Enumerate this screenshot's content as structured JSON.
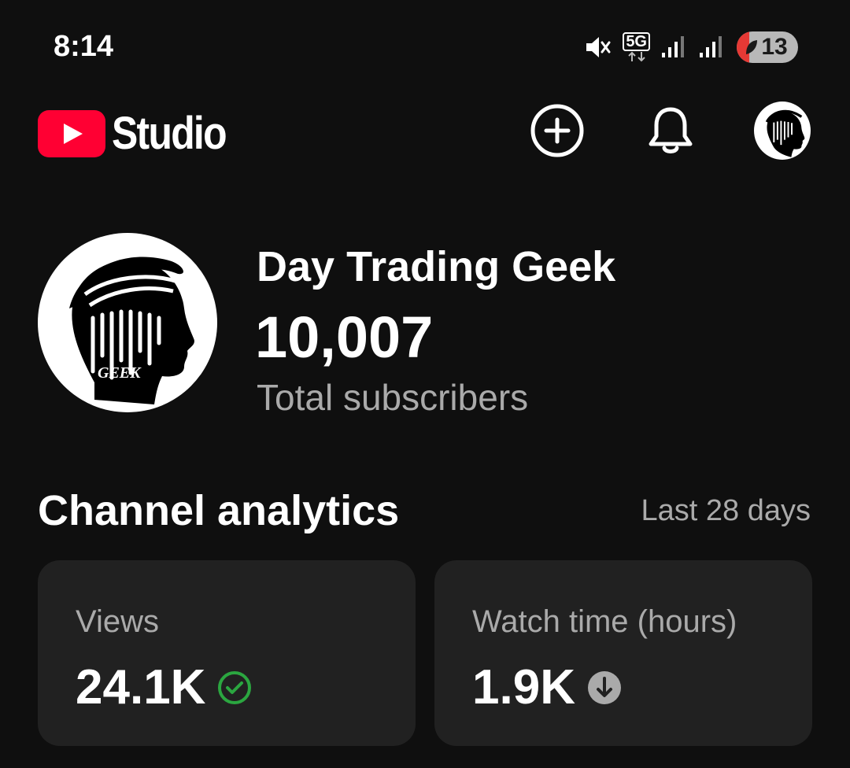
{
  "status_bar": {
    "time": "8:14",
    "network": "5G",
    "battery": "13",
    "icons": [
      "mute-icon",
      "5g-icon",
      "signal-icon",
      "signal-icon",
      "battery-icon"
    ]
  },
  "app_bar": {
    "logo_text": "Studio",
    "icons": [
      "create-icon",
      "bell-icon",
      "avatar"
    ],
    "brand_color": "#ff0033"
  },
  "channel": {
    "name": "Day Trading Geek",
    "subscriber_count": "10,007",
    "subscriber_label": "Total subscribers",
    "avatar_text": "GEEK"
  },
  "analytics": {
    "title": "Channel analytics",
    "period": "Last 28 days",
    "cards": [
      {
        "label": "Views",
        "value": "24.1K",
        "status_icon": "check-circle-icon",
        "status_color": "#2ba640"
      },
      {
        "label": "Watch time (hours)",
        "value": "1.9K",
        "status_icon": "arrow-down-circle-icon",
        "status_color": "#aaaaaa"
      }
    ]
  }
}
